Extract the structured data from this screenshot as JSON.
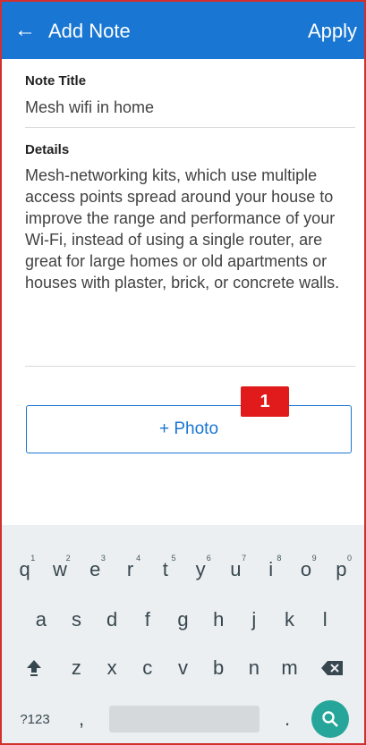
{
  "appbar": {
    "back_icon": "arrow-left-icon",
    "title": "Add Note",
    "apply_label": "Apply",
    "bg_color": "#1976d2"
  },
  "note_title": {
    "label": "Note Title",
    "value": "Mesh wifi in home"
  },
  "details": {
    "label": "Details",
    "value": "Mesh-networking kits, which use multiple access points spread around your house to improve the range and performance of your Wi-Fi, instead of using a single router, are great for large homes or old apartments or houses with plaster, brick, or concrete walls."
  },
  "photo_button": {
    "label": "+ Photo"
  },
  "badge": {
    "text": "1",
    "color": "#e11b1b"
  },
  "keyboard": {
    "row1": [
      {
        "key": "q",
        "hint": "1"
      },
      {
        "key": "w",
        "hint": "2"
      },
      {
        "key": "e",
        "hint": "3"
      },
      {
        "key": "r",
        "hint": "4"
      },
      {
        "key": "t",
        "hint": "5"
      },
      {
        "key": "y",
        "hint": "6"
      },
      {
        "key": "u",
        "hint": "7"
      },
      {
        "key": "i",
        "hint": "8"
      },
      {
        "key": "o",
        "hint": "9"
      },
      {
        "key": "p",
        "hint": "0"
      }
    ],
    "row2": [
      "a",
      "s",
      "d",
      "f",
      "g",
      "h",
      "j",
      "k",
      "l"
    ],
    "row3": [
      "z",
      "x",
      "c",
      "v",
      "b",
      "n",
      "m"
    ],
    "shift_icon": "shift-icon",
    "backspace_icon": "backspace-icon",
    "symbols_label": "?123",
    "comma": ",",
    "period": ".",
    "search_icon": "search-icon",
    "search_color": "#26a69a"
  }
}
